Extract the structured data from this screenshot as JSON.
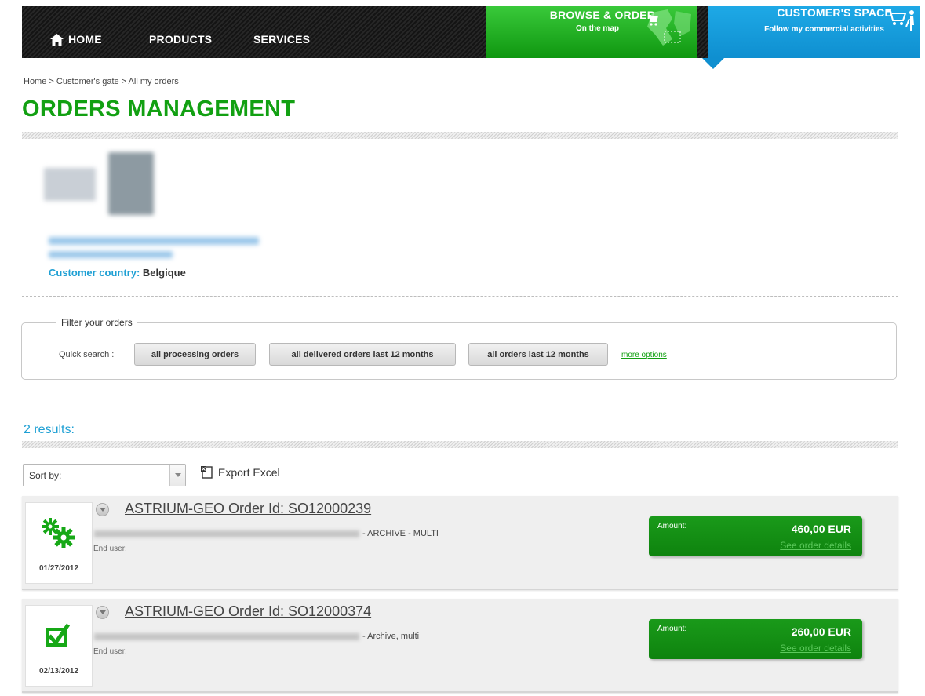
{
  "nav": {
    "home": "HOME",
    "products": "PRODUCTS",
    "services": "SERVICES",
    "browse_title": "BROWSE & ORDER",
    "browse_sub": "On the map",
    "customer_title": "CUSTOMER'S SPACE",
    "customer_sub": "Follow my commercial activities"
  },
  "breadcrumb": "Home > Customer's gate > All my orders",
  "title": "ORDERS MANAGEMENT",
  "customer": {
    "country_label": "Customer country:",
    "country_value": "Belgique"
  },
  "filter": {
    "legend": "Filter your orders",
    "quick_search_label": "Quick search :",
    "buttons": [
      "all processing orders",
      "all delivered orders last 12 months",
      "all orders last 12 months"
    ],
    "more_options": "more options"
  },
  "results_label": "2 results:",
  "sort": {
    "label": "Sort by:"
  },
  "export_label": "Export Excel",
  "orders": [
    {
      "status": "processing",
      "date": "01/27/2012",
      "title": "ASTRIUM-GEO Order Id: SO12000239",
      "type": "- ARCHIVE - MULTI",
      "end_user": "End user:",
      "amount_label": "Amount:",
      "amount": "460,00 EUR",
      "details_link": "See order details"
    },
    {
      "status": "delivered",
      "date": "02/13/2012",
      "title": "ASTRIUM-GEO Order Id: SO12000374",
      "type": "- Archive, multi",
      "end_user": "End user:",
      "amount_label": "Amount:",
      "amount": "260,00 EUR",
      "details_link": "See order details"
    }
  ],
  "colors": {
    "brand_green": "#12a012",
    "accent_blue": "#1fa0d4",
    "customer_blue": "#0f8fd0"
  },
  "icons": [
    "home-icon",
    "map-icon",
    "cart-icon",
    "gears-icon",
    "checkbox-icon",
    "chevron-down-icon",
    "excel-icon"
  ]
}
